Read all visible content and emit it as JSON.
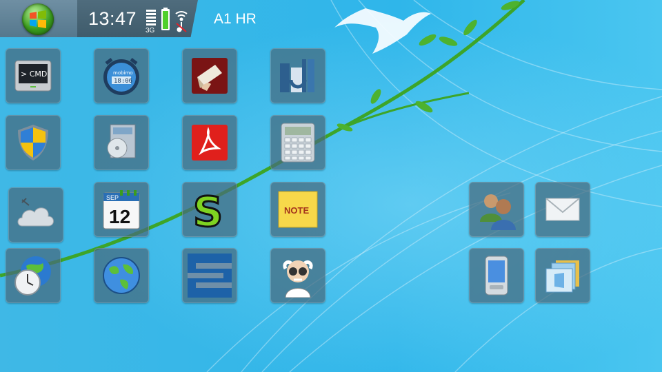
{
  "status_bar": {
    "time": "13:47",
    "network": "3G",
    "operator": "A1 HR"
  },
  "desktop_icons": [
    {
      "id": "cmd",
      "icon": "terminal-icon",
      "text": "> CMD"
    },
    {
      "id": "clock",
      "icon": "alarm-clock-icon",
      "text": "18:06"
    },
    {
      "id": "paint",
      "icon": "paint-app-icon"
    },
    {
      "id": "dict",
      "icon": "dictionary-icon"
    },
    {
      "id": "security",
      "icon": "shield-icon"
    },
    {
      "id": "installer",
      "icon": "software-install-icon"
    },
    {
      "id": "pdf",
      "icon": "pdf-reader-icon"
    },
    {
      "id": "calculator",
      "icon": "calculator-icon"
    },
    {
      "id": "weather",
      "icon": "weather-cloud-icon"
    },
    {
      "id": "calendar",
      "icon": "calendar-icon",
      "month": "SEP",
      "day": "12"
    },
    {
      "id": "s-app",
      "icon": "s-app-icon"
    },
    {
      "id": "note",
      "icon": "sticky-note-icon",
      "text": "NOTE"
    },
    {
      "id": "world-clock",
      "icon": "world-clock-icon"
    },
    {
      "id": "maps",
      "icon": "globe-map-icon"
    },
    {
      "id": "s-blue",
      "icon": "stacked-s-app-icon"
    },
    {
      "id": "professor",
      "icon": "professor-icon"
    },
    {
      "id": "contacts",
      "icon": "contacts-icon"
    },
    {
      "id": "mail",
      "icon": "mail-icon"
    },
    {
      "id": "device",
      "icon": "mobile-device-icon"
    },
    {
      "id": "files",
      "icon": "folder-windows-icon"
    }
  ]
}
